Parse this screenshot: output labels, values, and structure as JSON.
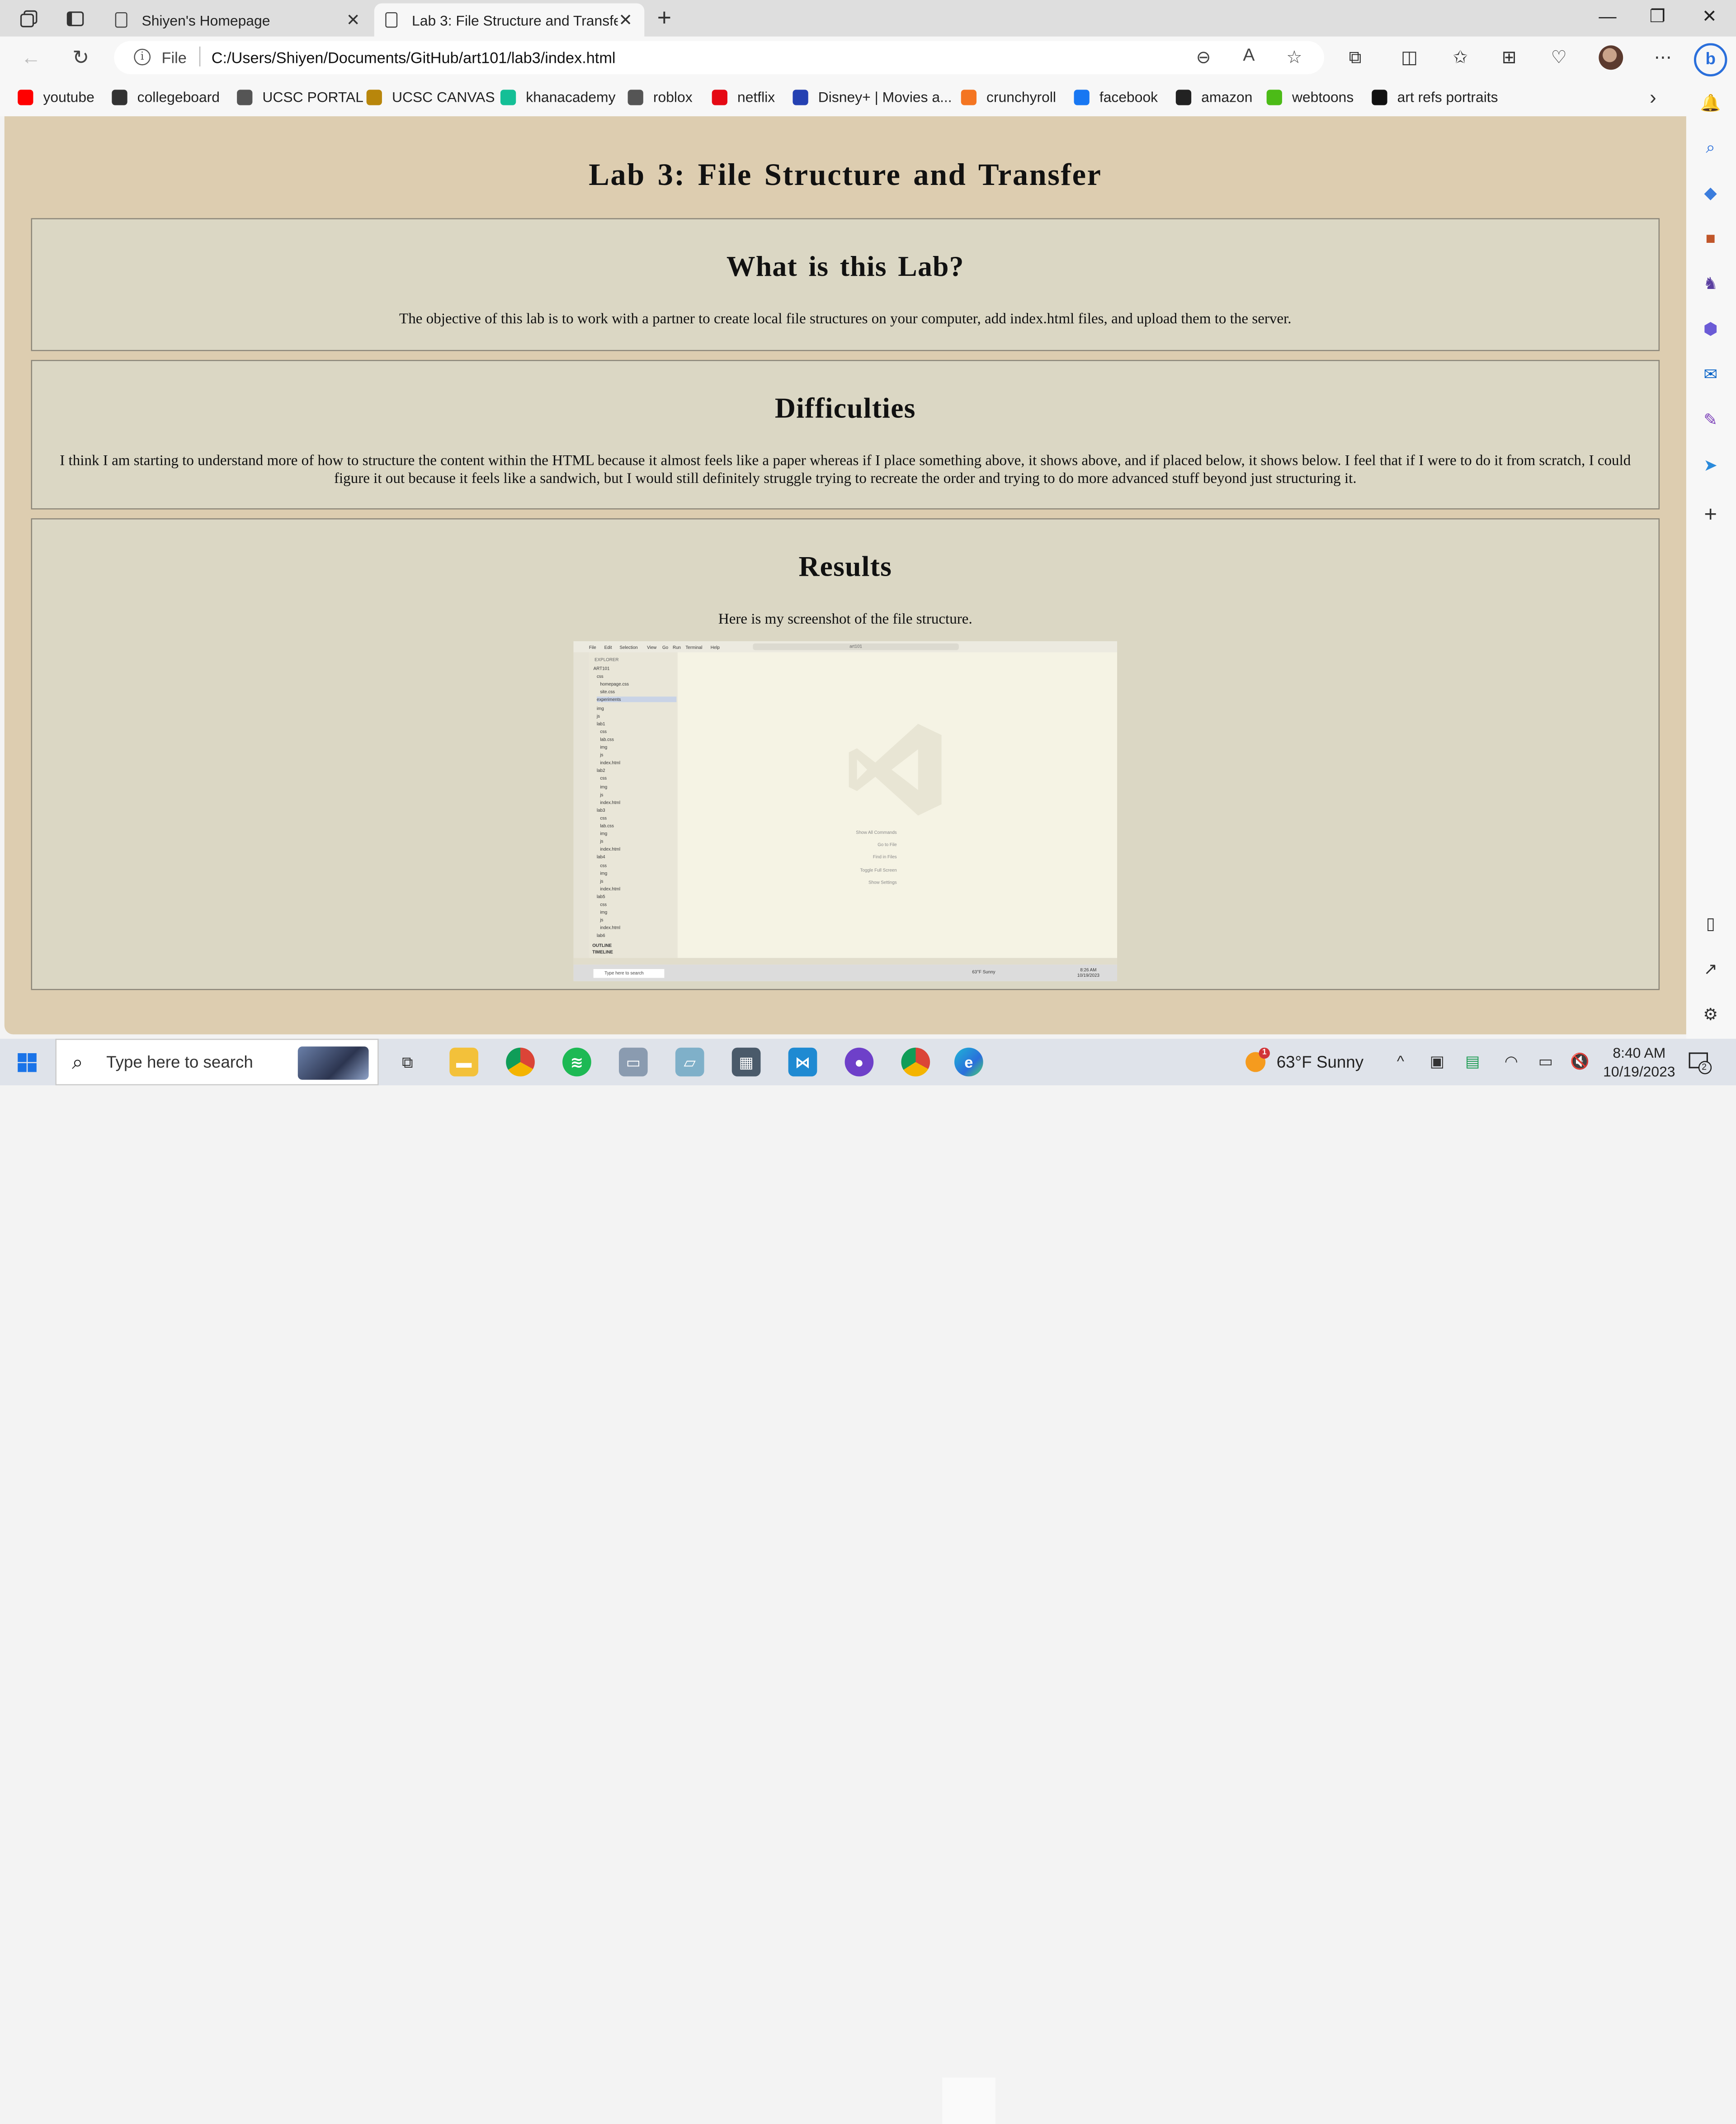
{
  "browser": {
    "tabs": [
      {
        "title": "Shiyen's Homepage",
        "active": false
      },
      {
        "title": "Lab 3: File Structure and Transfer",
        "active": true
      }
    ],
    "address": {
      "scheme": "File",
      "url": "C:/Users/Shiyen/Documents/GitHub/art101/lab3/index.html"
    },
    "favorites": [
      {
        "label": "youtube",
        "icon": "youtube-icon",
        "color": "#ff0000"
      },
      {
        "label": "collegeboard",
        "icon": "collegeboard-icon",
        "color": "#333333"
      },
      {
        "label": "UCSC PORTAL",
        "icon": "document-icon",
        "color": "#555555"
      },
      {
        "label": "UCSC CANVAS",
        "icon": "ucsc-canvas-icon",
        "color": "#b8860b"
      },
      {
        "label": "khanacademy",
        "icon": "khanacademy-icon",
        "color": "#14bf96"
      },
      {
        "label": "roblox",
        "icon": "roblox-icon",
        "color": "#555555"
      },
      {
        "label": "netflix",
        "icon": "netflix-icon",
        "color": "#e50914"
      },
      {
        "label": "Disney+ | Movies a...",
        "icon": "disney-icon",
        "color": "#2541b2"
      },
      {
        "label": "crunchyroll",
        "icon": "crunchyroll-icon",
        "color": "#f47521"
      },
      {
        "label": "facebook",
        "icon": "facebook-icon",
        "color": "#1877f2"
      },
      {
        "label": "amazon",
        "icon": "amazon-icon",
        "color": "#222222"
      },
      {
        "label": "webtoons",
        "icon": "webtoons-icon",
        "color": "#4cbb17"
      },
      {
        "label": "art refs portraits",
        "icon": "art-refs-icon",
        "color": "#111111"
      }
    ]
  },
  "page": {
    "title": "Lab 3: File Structure and Transfer",
    "sections": {
      "about": {
        "heading": "What is this Lab?",
        "text": "The objective of this lab is to work with a partner to create local file structures on your computer, add index.html files, and upload them to the server."
      },
      "difficulties": {
        "heading": "Difficulties",
        "text": "I think I am starting to understand more of how to structure the content within the HTML because it almost feels like a paper whereas if I place something above, it shows above, and if placed below, it shows below. I feel that if I were to do it from scratch, I could figure it out because it feels like a sandwich, but I would still definitely struggle trying to recreate the order and trying to do more advanced stuff beyond just structuring it."
      },
      "results": {
        "heading": "Results",
        "text": "Here is my screenshot of the file structure.",
        "screenshot": {
          "menu": [
            "File",
            "Edit",
            "Selection",
            "View",
            "Go",
            "Run",
            "Terminal",
            "Help"
          ],
          "search": "art101",
          "explorer_title": "EXPLORER",
          "tree": [
            "ART101",
            "css",
            "homepage.css",
            "site.css",
            "experiments",
            "img",
            "js",
            "lab1",
            "css",
            "lab.css",
            "img",
            "js",
            "index.html",
            "lab2",
            "css",
            "img",
            "js",
            "index.html",
            "lab3",
            "css",
            "lab.css",
            "img",
            "js",
            "index.html",
            "lab4",
            "css",
            "img",
            "js",
            "index.html",
            "lab5",
            "css",
            "img",
            "js",
            "index.html",
            "lab6"
          ],
          "shortcuts": [
            "Show All Commands",
            "Go to File",
            "Find in Files",
            "Toggle Full Screen",
            "Show Settings"
          ],
          "panels": [
            "OUTLINE",
            "TIMELINE"
          ],
          "taskbar_search": "Type here to search",
          "weather": "63°F Sunny",
          "time": "8:26 AM",
          "date": "10/19/2023"
        }
      }
    }
  },
  "taskbar": {
    "search_placeholder": "Type here to search",
    "weather_temp": "63°F",
    "weather_desc": "Sunny",
    "weather_badge": "1",
    "time": "8:40 AM",
    "date": "10/19/2023",
    "notification_count": "2"
  }
}
